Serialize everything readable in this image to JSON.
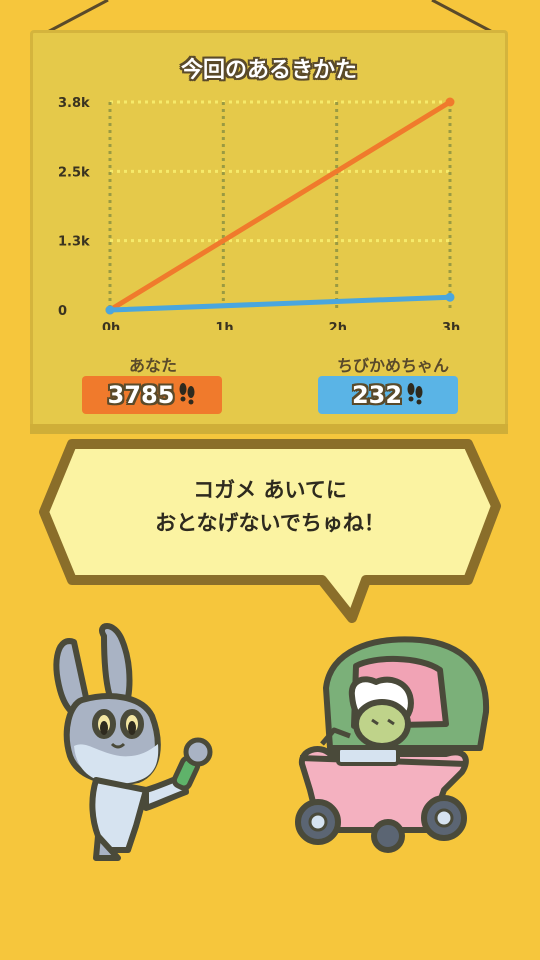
{
  "chart_data": {
    "type": "line",
    "title": "今回のあるきかた",
    "x_ticks": [
      "0h",
      "1h",
      "2h",
      "3h"
    ],
    "y_ticks": [
      "0",
      "1.3k",
      "2.5k",
      "3.8k"
    ],
    "x": [
      0,
      3
    ],
    "xlim": [
      0,
      3
    ],
    "ylim": [
      0,
      3785
    ],
    "grid": true,
    "series": [
      {
        "name": "あなた",
        "x": [
          0,
          3
        ],
        "values": [
          0,
          3785
        ],
        "color": "#f07a2c"
      },
      {
        "name": "ちびかめちゃん",
        "x": [
          0,
          3
        ],
        "values": [
          0,
          232
        ],
        "color": "#4aa6de"
      }
    ]
  },
  "players": [
    {
      "name": "あなた",
      "steps": "3785",
      "color": "#f07a2c",
      "icon": "footprints-icon"
    },
    {
      "name": "ちびかめちゃん",
      "steps": "232",
      "color": "#5ab4e6",
      "icon": "footprints-icon"
    }
  ],
  "dialogue": {
    "line1": "コガメ あいてに",
    "line2": "おとなげないでちゅね！"
  },
  "characters": [
    {
      "name": "rabbit-with-microphone"
    },
    {
      "name": "baby-turtle-in-stroller"
    }
  ],
  "colors": {
    "background": "#f6c63c",
    "board": "#e5c94a",
    "grid": "#f6ea6a",
    "outline": "#5a4a2a"
  }
}
